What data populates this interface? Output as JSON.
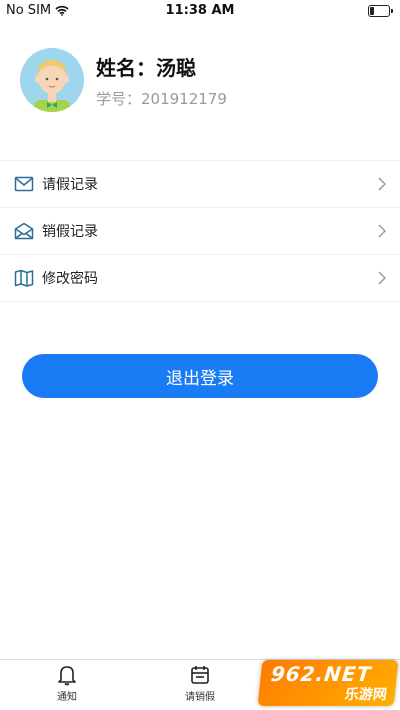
{
  "status_bar": {
    "carrier": "No SIM",
    "time": "11:38 AM"
  },
  "profile": {
    "name": "姓名：汤聪",
    "student_id": "学号：201912179"
  },
  "menu": {
    "items": [
      {
        "label": "请假记录",
        "icon": "mail-icon"
      },
      {
        "label": "销假记录",
        "icon": "mail-open-icon"
      },
      {
        "label": "修改密码",
        "icon": "map-icon"
      }
    ]
  },
  "logout_label": "退出登录",
  "tabbar": {
    "tabs": [
      {
        "label": "通知",
        "icon": "bell-icon"
      },
      {
        "label": "请销假",
        "icon": "calendar-icon"
      }
    ]
  },
  "watermark": {
    "line1": "962.NET",
    "line2": "乐游网"
  },
  "colors": {
    "accent": "#1a7cf5",
    "icon": "#2a6f9a",
    "avatar_bg": "#9ed6ee"
  }
}
